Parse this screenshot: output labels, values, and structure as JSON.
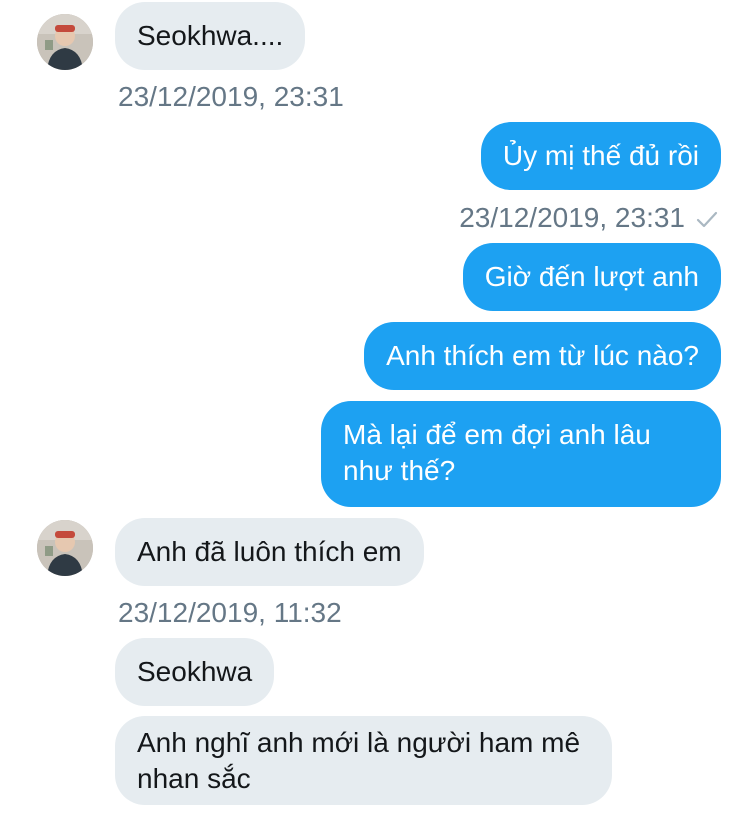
{
  "messages": [
    {
      "direction": "in",
      "text": "Seokhwa...."
    },
    {
      "direction": "in_stamp",
      "text": "23/12/2019, 23:31"
    },
    {
      "direction": "out",
      "text": "Ủy mị thế đủ rồi"
    },
    {
      "direction": "out_stamp",
      "text": "23/12/2019, 23:31",
      "status_icon": "checkmark-icon"
    },
    {
      "direction": "out",
      "text": "Giờ đến lượt anh"
    },
    {
      "direction": "out",
      "text": "Anh thích em từ lúc nào?"
    },
    {
      "direction": "out",
      "text": "Mà lại để em đợi anh lâu như thế?"
    },
    {
      "direction": "in",
      "text": "Anh đã luôn thích em"
    },
    {
      "direction": "in_stamp",
      "text": "23/12/2019, 11:32"
    },
    {
      "direction": "in",
      "text": "Seokhwa"
    },
    {
      "direction": "in",
      "text": "Anh nghĩ anh mới là người ham mê nhan sắc"
    }
  ],
  "colors": {
    "incoming_bubble": "#e6ecf0",
    "outgoing_bubble": "#1da1f2",
    "timestamp": "#657786",
    "check": "#aab8c2"
  }
}
